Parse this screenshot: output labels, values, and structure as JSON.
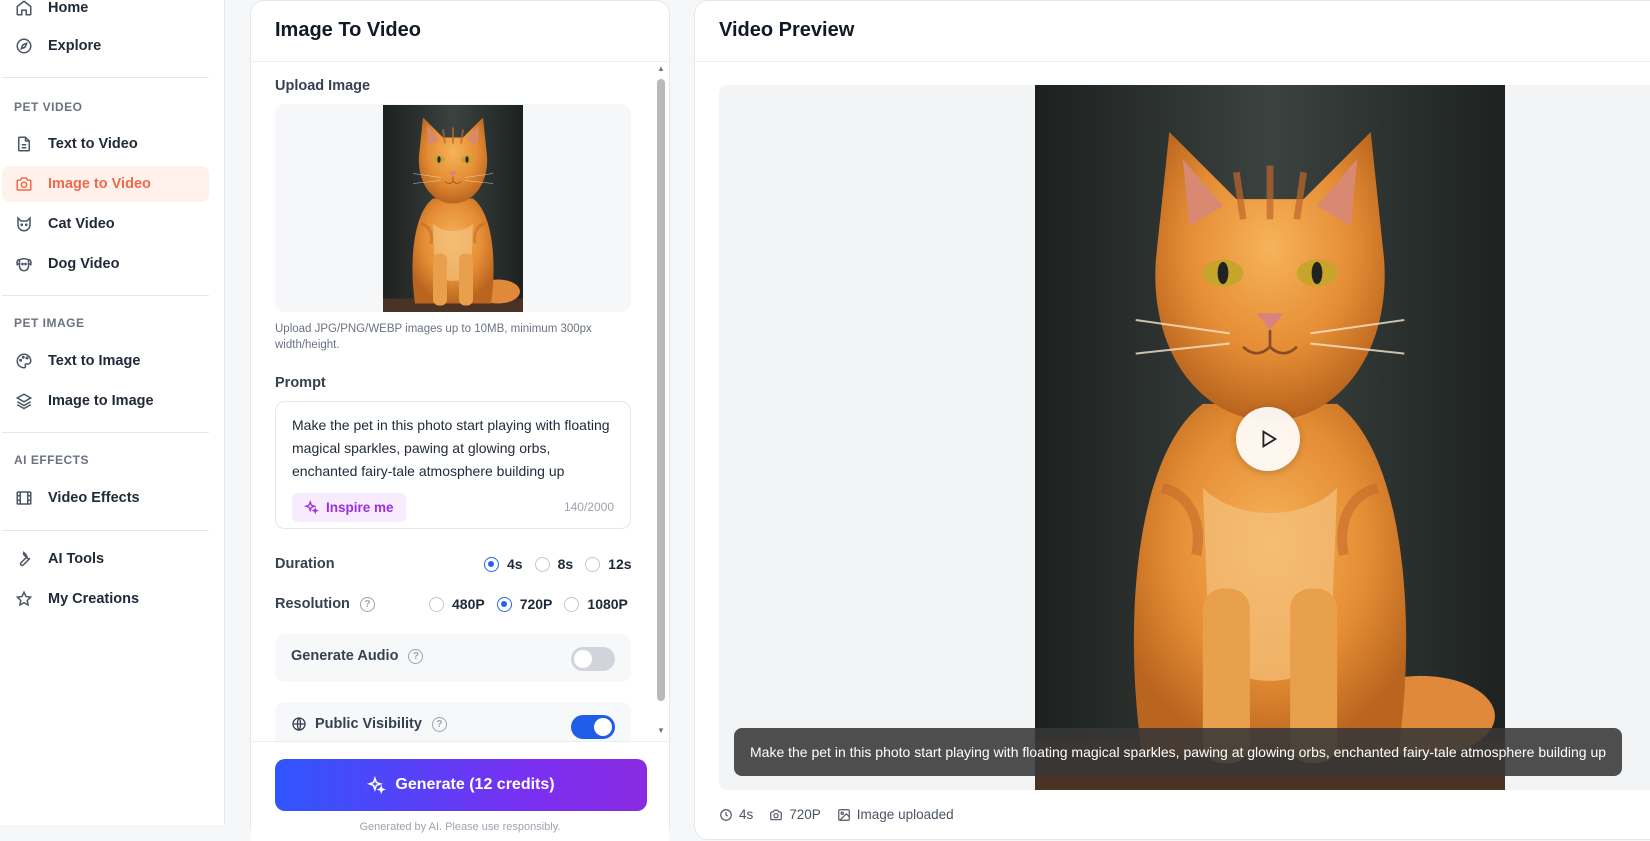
{
  "sidebar": {
    "top_items": [
      {
        "label": "Home",
        "icon": "home-icon"
      },
      {
        "label": "Explore",
        "icon": "compass-icon"
      }
    ],
    "sections": [
      {
        "title": "PET VIDEO",
        "items": [
          {
            "label": "Text to Video",
            "icon": "document-icon"
          },
          {
            "label": "Image to Video",
            "icon": "camera-icon",
            "active": true
          },
          {
            "label": "Cat Video",
            "icon": "cat-icon"
          },
          {
            "label": "Dog Video",
            "icon": "dog-icon"
          }
        ]
      },
      {
        "title": "PET IMAGE",
        "items": [
          {
            "label": "Text to Image",
            "icon": "palette-icon"
          },
          {
            "label": "Image to Image",
            "icon": "layers-icon"
          }
        ]
      },
      {
        "title": "AI EFFECTS",
        "items": [
          {
            "label": "Video Effects",
            "icon": "film-icon"
          }
        ]
      }
    ],
    "bottom_items": [
      {
        "label": "AI Tools",
        "icon": "wrench-icon"
      },
      {
        "label": "My Creations",
        "icon": "star-icon"
      }
    ]
  },
  "form": {
    "title": "Image To Video",
    "upload_label": "Upload Image",
    "upload_hint": "Upload JPG/PNG/WEBP images up to 10MB, minimum 300px width/height.",
    "prompt_label": "Prompt",
    "prompt_value": "Make the pet in this photo start playing with floating magical sparkles, pawing at glowing orbs, enchanted fairy-tale atmosphere building up",
    "inspire_label": "Inspire me",
    "char_count": "140/2000",
    "duration_label": "Duration",
    "duration_options": [
      "4s",
      "8s",
      "12s"
    ],
    "duration_selected": "4s",
    "resolution_label": "Resolution",
    "resolution_options": [
      "480P",
      "720P",
      "1080P"
    ],
    "resolution_selected": "720P",
    "audio_label": "Generate Audio",
    "audio_on": false,
    "visibility_label": "Public Visibility",
    "visibility_on": true,
    "generate_label": "Generate (12 credits)",
    "disclaimer": "Generated by AI. Please use responsibly."
  },
  "preview": {
    "title": "Video Preview",
    "caption": "Make the pet in this photo start playing with floating magical sparkles, pawing at glowing orbs, enchanted fairy-tale atmosphere building up",
    "meta_duration": "4s",
    "meta_resolution": "720P",
    "meta_status": "Image uploaded"
  },
  "colors": {
    "accent": "#2563eb",
    "active_nav_text": "#f06a4a",
    "active_nav_bg": "#fff1ec",
    "inspire_text": "#9c2fd8",
    "generate_gradient_start": "#2f55ff",
    "generate_gradient_end": "#8a2be2"
  }
}
